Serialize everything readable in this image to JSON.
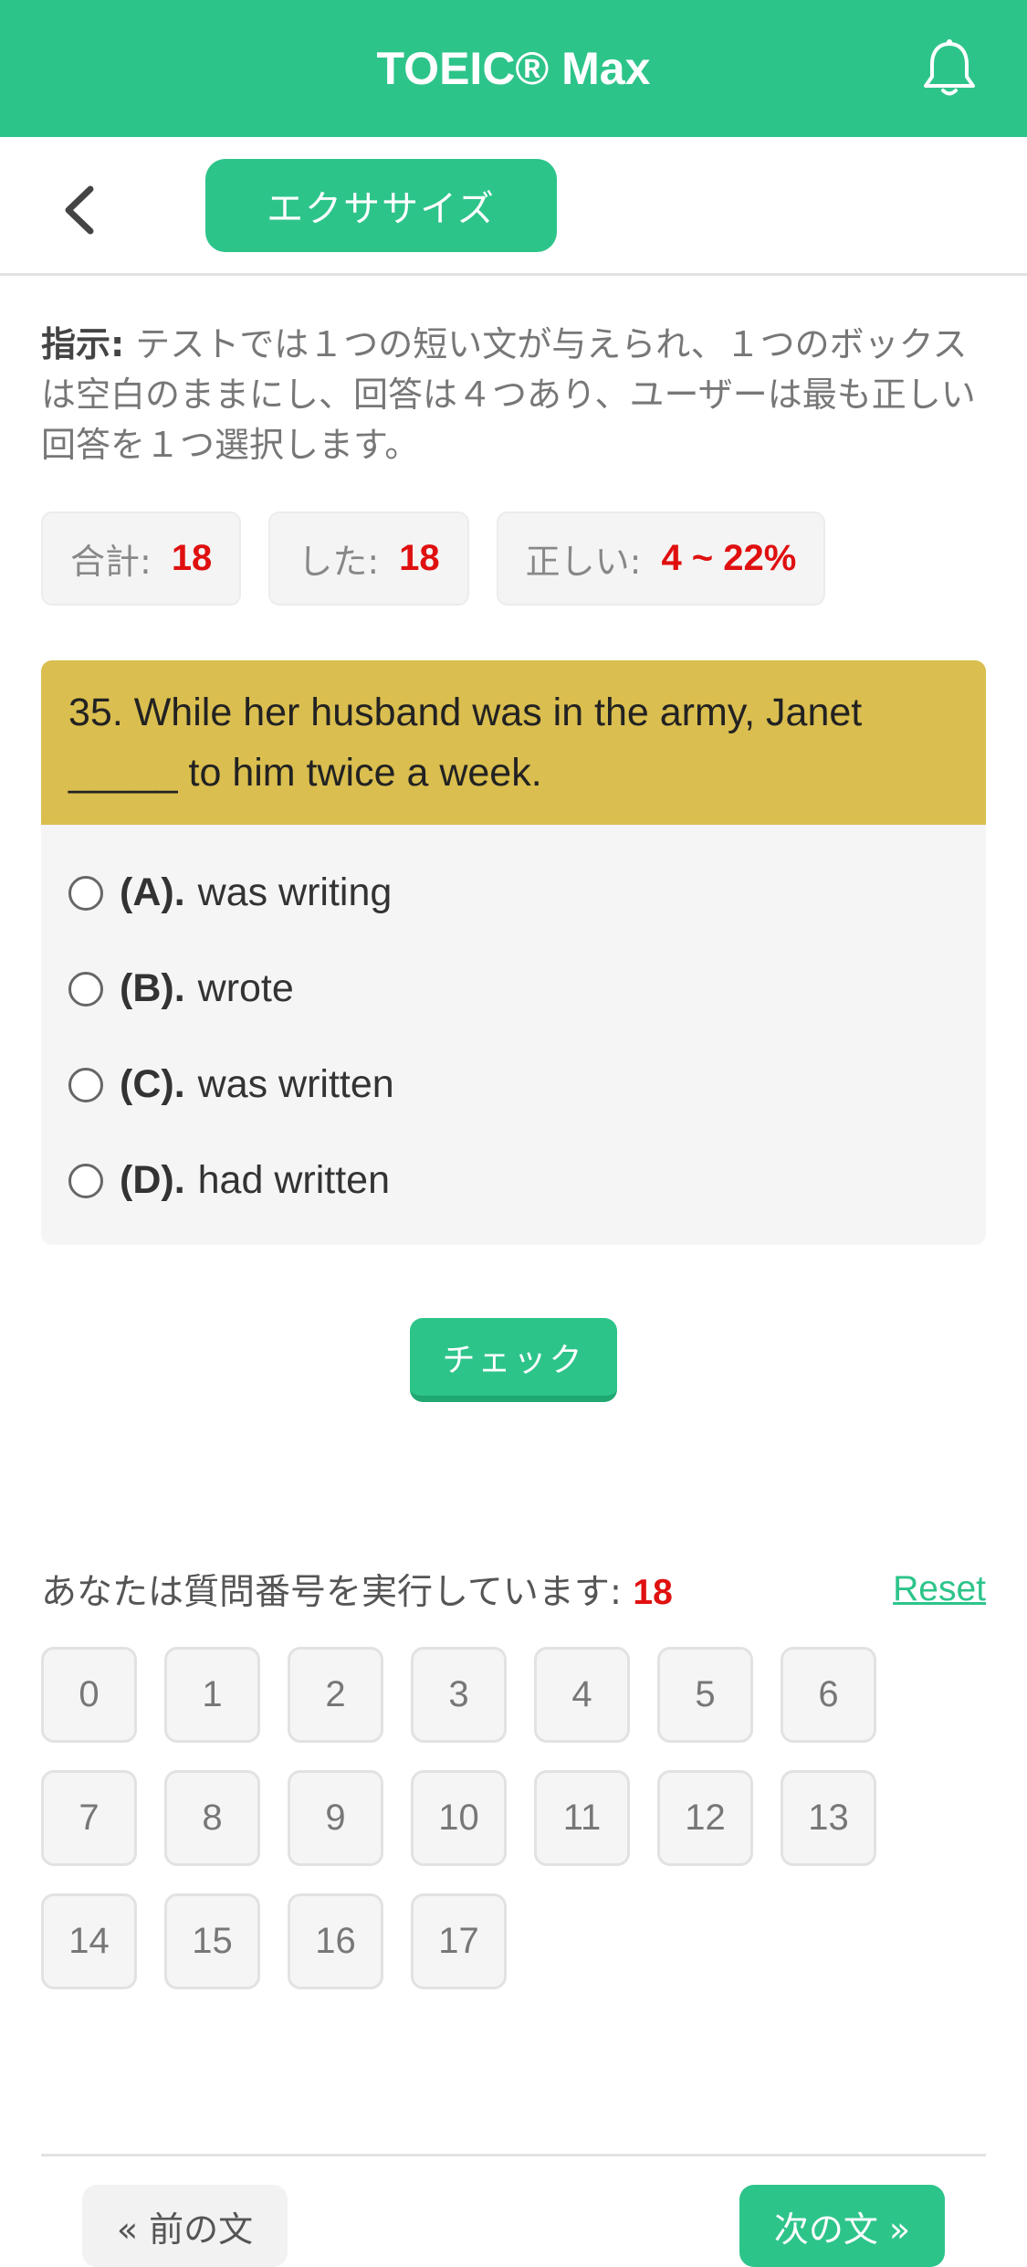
{
  "header": {
    "title": "TOEIC® Max",
    "bell_icon": "bell-icon"
  },
  "subbar": {
    "back_icon": "chevron-left-icon",
    "tab_label": "エクササイズ"
  },
  "instructions": {
    "label": "指示:",
    "text": " テストでは１つの短い文が与えられ、１つのボックスは空白のままにし、回答は４つあり、ユーザーは最も正しい回答を１つ選択します。"
  },
  "stats": {
    "total_label": "合計:",
    "total_value": "18",
    "done_label": "した:",
    "done_value": "18",
    "correct_label": "正しい:",
    "correct_value": "4 ~ 22%"
  },
  "question": {
    "text": "35. While her husband was in the army, Janet _____ to him twice a week.",
    "options": [
      {
        "key": "(A).",
        "text": "was writing"
      },
      {
        "key": "(B).",
        "text": "wrote"
      },
      {
        "key": "(C).",
        "text": "was written"
      },
      {
        "key": "(D).",
        "text": "had written"
      }
    ]
  },
  "check_label": "チェック",
  "progress": {
    "label": "あなたは質問番号を実行しています:",
    "current": "18",
    "reset_label": "Reset"
  },
  "question_numbers": [
    "0",
    "1",
    "2",
    "3",
    "4",
    "5",
    "6",
    "7",
    "8",
    "9",
    "10",
    "11",
    "12",
    "13",
    "14",
    "15",
    "16",
    "17"
  ],
  "nav": {
    "prev_label": "« 前の文",
    "next_label": "次の文 »"
  },
  "colors": {
    "brand": "#2dc48a",
    "question_header": "#dabe4f",
    "highlight": "#e01010"
  }
}
